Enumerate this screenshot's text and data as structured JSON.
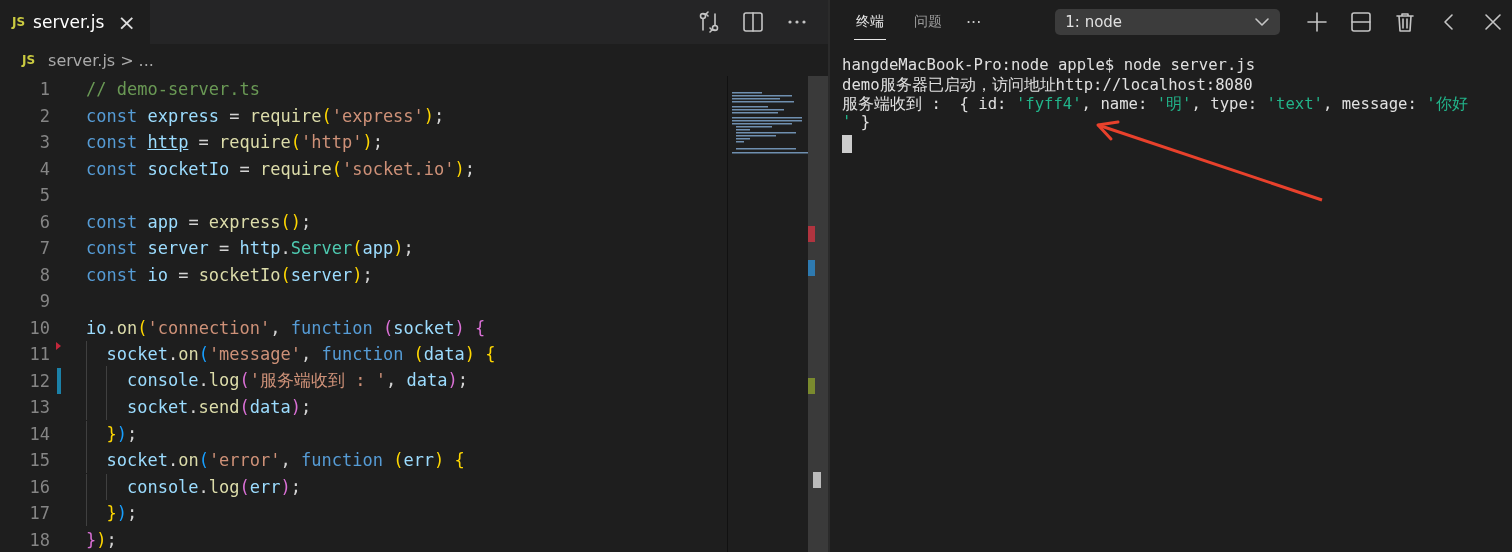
{
  "editor": {
    "tab": {
      "label": "server.js",
      "badge": "JS",
      "selected": true,
      "close": "×"
    },
    "breadcrumb": {
      "badge": "JS",
      "file": "server.js",
      "separator": ">",
      "rest": "..."
    },
    "lines": [
      {
        "number": "1",
        "tokens": [
          {
            "text": "// demo-server.ts",
            "kind": "comment"
          }
        ]
      },
      {
        "number": "2",
        "tokens": [
          {
            "text": "const ",
            "kind": "keyword"
          },
          {
            "text": "express",
            "kind": "var"
          },
          {
            "text": " = ",
            "kind": "punct"
          },
          {
            "text": "require",
            "kind": "fn"
          },
          {
            "text": "(",
            "kind": "b1"
          },
          {
            "text": "'express'",
            "kind": "string"
          },
          {
            "text": ")",
            "kind": "b1"
          },
          {
            "text": ";",
            "kind": "punct"
          }
        ]
      },
      {
        "number": "3",
        "tokens": [
          {
            "text": "const ",
            "kind": "keyword"
          },
          {
            "text": "http",
            "kind": "link"
          },
          {
            "text": " = ",
            "kind": "punct"
          },
          {
            "text": "require",
            "kind": "fn"
          },
          {
            "text": "(",
            "kind": "b1"
          },
          {
            "text": "'http'",
            "kind": "string"
          },
          {
            "text": ")",
            "kind": "b1"
          },
          {
            "text": ";",
            "kind": "punct"
          }
        ]
      },
      {
        "number": "4",
        "tokens": [
          {
            "text": "const ",
            "kind": "keyword"
          },
          {
            "text": "socketIo",
            "kind": "var"
          },
          {
            "text": " = ",
            "kind": "punct"
          },
          {
            "text": "require",
            "kind": "fn"
          },
          {
            "text": "(",
            "kind": "b1"
          },
          {
            "text": "'socket.io'",
            "kind": "string"
          },
          {
            "text": ")",
            "kind": "b1"
          },
          {
            "text": ";",
            "kind": "punct"
          }
        ]
      },
      {
        "number": "5"
      },
      {
        "number": "6",
        "tokens": [
          {
            "text": "const ",
            "kind": "keyword"
          },
          {
            "text": "app",
            "kind": "var"
          },
          {
            "text": " = ",
            "kind": "punct"
          },
          {
            "text": "express",
            "kind": "fn"
          },
          {
            "text": "()",
            "kind": "b1"
          },
          {
            "text": ";",
            "kind": "punct"
          }
        ]
      },
      {
        "number": "7",
        "tokens": [
          {
            "text": "const ",
            "kind": "keyword"
          },
          {
            "text": "server",
            "kind": "var"
          },
          {
            "text": " = ",
            "kind": "punct"
          },
          {
            "text": "http",
            "kind": "var"
          },
          {
            "text": ".",
            "kind": "punct"
          },
          {
            "text": "Server",
            "kind": "class"
          },
          {
            "text": "(",
            "kind": "b1"
          },
          {
            "text": "app",
            "kind": "var"
          },
          {
            "text": ")",
            "kind": "b1"
          },
          {
            "text": ";",
            "kind": "punct"
          }
        ]
      },
      {
        "number": "8",
        "tokens": [
          {
            "text": "const ",
            "kind": "keyword"
          },
          {
            "text": "io",
            "kind": "var"
          },
          {
            "text": " = ",
            "kind": "punct"
          },
          {
            "text": "socketIo",
            "kind": "fn"
          },
          {
            "text": "(",
            "kind": "b1"
          },
          {
            "text": "server",
            "kind": "var"
          },
          {
            "text": ")",
            "kind": "b1"
          },
          {
            "text": ";",
            "kind": "punct"
          }
        ]
      },
      {
        "number": "9"
      },
      {
        "number": "10",
        "tokens": [
          {
            "text": "io",
            "kind": "var"
          },
          {
            "text": ".",
            "kind": "punct"
          },
          {
            "text": "on",
            "kind": "fn"
          },
          {
            "text": "(",
            "kind": "b1"
          },
          {
            "text": "'connection'",
            "kind": "string"
          },
          {
            "text": ", ",
            "kind": "punct"
          },
          {
            "text": "function ",
            "kind": "keyword"
          },
          {
            "text": "(",
            "kind": "b2"
          },
          {
            "text": "socket",
            "kind": "var"
          },
          {
            "text": ") {",
            "kind": "b2"
          }
        ]
      },
      {
        "number": "11",
        "fold_marker": true,
        "modified": false,
        "tokens": [
          {
            "text": "  socket",
            "kind": "var"
          },
          {
            "text": ".",
            "kind": "punct"
          },
          {
            "text": "on",
            "kind": "fn"
          },
          {
            "text": "(",
            "kind": "b3"
          },
          {
            "text": "'message'",
            "kind": "string"
          },
          {
            "text": ", ",
            "kind": "punct"
          },
          {
            "text": "function ",
            "kind": "keyword"
          },
          {
            "text": "(",
            "kind": "b1"
          },
          {
            "text": "data",
            "kind": "var"
          },
          {
            "text": ") {",
            "kind": "b1"
          }
        ]
      },
      {
        "number": "12",
        "fold_marker": false,
        "modified": true,
        "tokens": [
          {
            "text": "    console",
            "kind": "var"
          },
          {
            "text": ".",
            "kind": "punct"
          },
          {
            "text": "log",
            "kind": "fn"
          },
          {
            "text": "(",
            "kind": "b2"
          },
          {
            "text": "'服务端收到 : '",
            "kind": "string"
          },
          {
            "text": ", ",
            "kind": "punct"
          },
          {
            "text": "data",
            "kind": "var"
          },
          {
            "text": ")",
            "kind": "b2"
          },
          {
            "text": ";",
            "kind": "punct"
          }
        ]
      },
      {
        "number": "13",
        "tokens": [
          {
            "text": "    socket",
            "kind": "var"
          },
          {
            "text": ".",
            "kind": "punct"
          },
          {
            "text": "send",
            "kind": "fn"
          },
          {
            "text": "(",
            "kind": "b2"
          },
          {
            "text": "data",
            "kind": "var"
          },
          {
            "text": ")",
            "kind": "b2"
          },
          {
            "text": ";",
            "kind": "punct"
          }
        ]
      },
      {
        "number": "14",
        "tokens": [
          {
            "text": "  }",
            "kind": "b1"
          },
          {
            "text": ")",
            "kind": "b3"
          },
          {
            "text": ";",
            "kind": "punct"
          }
        ]
      },
      {
        "number": "15",
        "tokens": [
          {
            "text": "  socket",
            "kind": "var"
          },
          {
            "text": ".",
            "kind": "punct"
          },
          {
            "text": "on",
            "kind": "fn"
          },
          {
            "text": "(",
            "kind": "b3"
          },
          {
            "text": "'error'",
            "kind": "string"
          },
          {
            "text": ", ",
            "kind": "punct"
          },
          {
            "text": "function ",
            "kind": "keyword"
          },
          {
            "text": "(",
            "kind": "b1"
          },
          {
            "text": "err",
            "kind": "var"
          },
          {
            "text": ") {",
            "kind": "b1"
          }
        ]
      },
      {
        "number": "16",
        "tokens": [
          {
            "text": "    console",
            "kind": "var"
          },
          {
            "text": ".",
            "kind": "punct"
          },
          {
            "text": "log",
            "kind": "fn"
          },
          {
            "text": "(",
            "kind": "b2"
          },
          {
            "text": "err",
            "kind": "var"
          },
          {
            "text": ")",
            "kind": "b2"
          },
          {
            "text": ";",
            "kind": "punct"
          }
        ]
      },
      {
        "number": "17",
        "tokens": [
          {
            "text": "  }",
            "kind": "b1"
          },
          {
            "text": ")",
            "kind": "b3"
          },
          {
            "text": ";",
            "kind": "punct"
          }
        ]
      },
      {
        "number": "18",
        "tokens": [
          {
            "text": "}",
            "kind": "b2"
          },
          {
            "text": ")",
            "kind": "b1"
          },
          {
            "text": ";",
            "kind": "punct"
          }
        ]
      }
    ]
  },
  "terminal": {
    "tabs": [
      {
        "label": "终端",
        "selected": true
      },
      {
        "label": "问题",
        "selected": false
      }
    ],
    "more": "···",
    "dropdown": "1: node",
    "lines": [
      [
        {
          "text": "hangdeMacBook-Pro:node apple$ node server.js",
          "kind": "plain"
        }
      ],
      [
        {
          "text": "demo服务器已启动，访问地址http://localhost:8080",
          "kind": "plain"
        }
      ],
      [
        {
          "text": "服务端收到 :  { id: ",
          "kind": "plain"
        },
        {
          "text": "'fyff4'",
          "kind": "string"
        },
        {
          "text": ", name: ",
          "kind": "plain"
        },
        {
          "text": "'明'",
          "kind": "string"
        },
        {
          "text": ", type: ",
          "kind": "plain"
        },
        {
          "text": "'text'",
          "kind": "string"
        },
        {
          "text": ", message: ",
          "kind": "plain"
        },
        {
          "text": "'你好",
          "kind": "string"
        }
      ],
      [
        {
          "text": "'",
          "kind": "string"
        },
        {
          "text": " }",
          "kind": "plain"
        }
      ]
    ]
  }
}
